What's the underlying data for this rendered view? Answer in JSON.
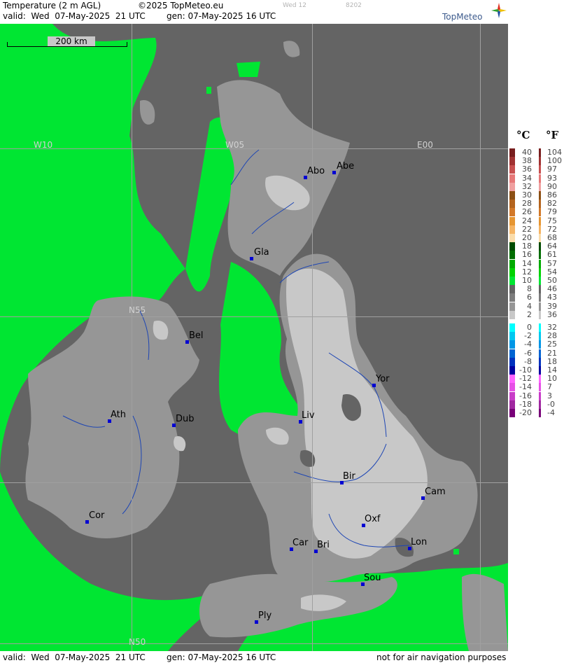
{
  "header": {
    "product": "Temperature (2 m AGL)",
    "copyright": "©2025 TopMeteo.eu",
    "faint_day": "Wed 12",
    "faint_code": "8202",
    "valid": "valid:  Wed  07-May-2025  21 UTC",
    "gen": "gen: 07-May-2025 16 UTC",
    "brand": "TopMeteo"
  },
  "footer": {
    "valid": "valid:  Wed  07-May-2025  21 UTC",
    "gen": "gen: 07-May-2025 16 UTC",
    "disclaimer": "not for air navigation purposes"
  },
  "map": {
    "scale_label": "200 km",
    "coords": [
      "W10",
      "W05",
      "E00",
      "N55",
      "N50"
    ],
    "cities": [
      "Abo",
      "Abe",
      "Gla",
      "Bel",
      "Yor",
      "Ath",
      "Dub",
      "Liv",
      "Bir",
      "Cam",
      "Cor",
      "Oxf",
      "Car",
      "Bri",
      "Lon",
      "Sou",
      "Ply"
    ],
    "colors": {
      "sea": "#646464",
      "band_10_12": "#00e632",
      "band_6_8": "#969696",
      "band_2_4": "#c8c8c8"
    }
  },
  "legend": {
    "celsius_header": "°C",
    "fahrenheit_header": "°F",
    "celsius": [
      "40",
      "38",
      "36",
      "34",
      "32",
      "30",
      "28",
      "26",
      "24",
      "22",
      "20",
      "18",
      "16",
      "14",
      "12",
      "10",
      "8",
      "6",
      "4",
      "2",
      "0",
      "-2",
      "-4",
      "-6",
      "-8",
      "-10",
      "-12",
      "-14",
      "-16",
      "-18",
      "-20"
    ],
    "fahrenheit": [
      "104",
      "100",
      "97",
      "93",
      "90",
      "86",
      "82",
      "79",
      "75",
      "72",
      "68",
      "64",
      "61",
      "57",
      "54",
      "50",
      "46",
      "43",
      "39",
      "36",
      "32",
      "28",
      "25",
      "21",
      "18",
      "14",
      "10",
      "7",
      "3",
      "-0",
      "-4"
    ],
    "colors": [
      "#781e1e",
      "#a03232",
      "#c85050",
      "#e67878",
      "#f0a0a0",
      "#8c5014",
      "#b4641e",
      "#d27828",
      "#e69632",
      "#f5b464",
      "#fadcaa",
      "#004b00",
      "#006e00",
      "#00aa00",
      "#00d200",
      "#00e632",
      "#646464",
      "#7d7d7d",
      "#969696",
      "#c8c8c8",
      "#00ffff",
      "#00c8f0",
      "#0096e6",
      "#0064d2",
      "#0032be",
      "#0000a0",
      "#ff64ff",
      "#e650e6",
      "#c83cc8",
      "#a028a0",
      "#780078"
    ]
  }
}
